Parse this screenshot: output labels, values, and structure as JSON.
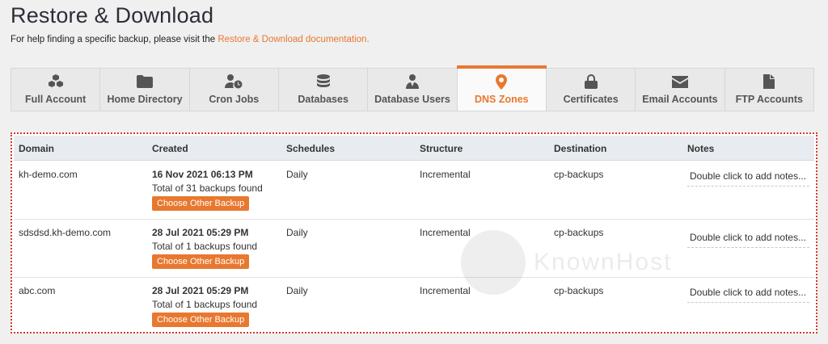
{
  "page": {
    "title": "Restore & Download",
    "help_prefix": "For help finding a specific backup, please visit the ",
    "help_link": "Restore & Download documentation."
  },
  "tabs": [
    {
      "label": "Full Account",
      "icon": "cubes-icon"
    },
    {
      "label": "Home Directory",
      "icon": "folder-icon"
    },
    {
      "label": "Cron Jobs",
      "icon": "user-clock-icon"
    },
    {
      "label": "Databases",
      "icon": "database-icon"
    },
    {
      "label": "Database Users",
      "icon": "user-tie-icon"
    },
    {
      "label": "DNS Zones",
      "icon": "map-marker-icon",
      "active": true
    },
    {
      "label": "Certificates",
      "icon": "lock-icon"
    },
    {
      "label": "Email Accounts",
      "icon": "envelope-icon"
    },
    {
      "label": "FTP Accounts",
      "icon": "file-icon"
    }
  ],
  "table": {
    "headers": [
      "Domain",
      "Created",
      "Schedules",
      "Structure",
      "Destination",
      "Notes"
    ],
    "rows": [
      {
        "domain": "kh-demo.com",
        "created_date": "16 Nov 2021 06:13 PM",
        "created_total": "Total of 31 backups found",
        "schedule": "Daily",
        "structure": "Incremental",
        "destination": "cp-backups",
        "notes": "Double click to add notes..."
      },
      {
        "domain": "sdsdsd.kh-demo.com",
        "created_date": "28 Jul 2021 05:29 PM",
        "created_total": "Total of 1 backups found",
        "schedule": "Daily",
        "structure": "Incremental",
        "destination": "cp-backups",
        "notes": "Double click to add notes..."
      },
      {
        "domain": "abc.com",
        "created_date": "28 Jul 2021 05:29 PM",
        "created_total": "Total of 1 backups found",
        "schedule": "Daily",
        "structure": "Incremental",
        "destination": "cp-backups",
        "notes": "Double click to add notes..."
      }
    ],
    "choose_label": "Choose Other Backup"
  },
  "watermark": "KnownHost",
  "colors": {
    "accent": "#e8782f",
    "highlight_border": "#d9372b"
  }
}
